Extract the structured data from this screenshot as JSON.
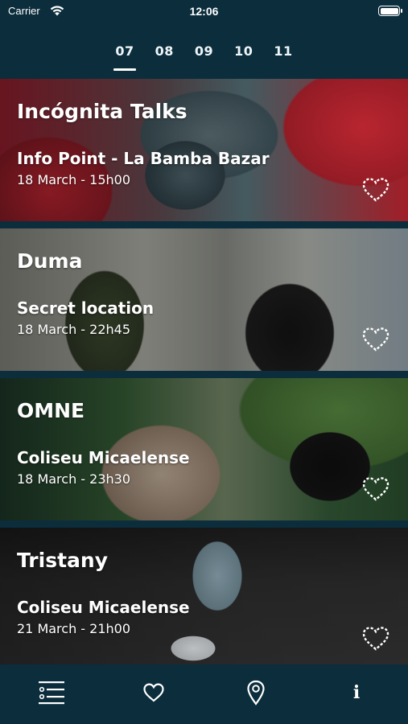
{
  "status_bar": {
    "carrier": "Carrier",
    "time": "12:06",
    "battery_level": 1.0,
    "icons": [
      "wifi-icon",
      "battery-icon"
    ]
  },
  "date_tabs": {
    "selected": "07",
    "items": [
      "07",
      "08",
      "09",
      "10",
      "11"
    ]
  },
  "events": [
    {
      "title": "Incógnita Talks",
      "venue": "Info Point - La Bamba Bazar",
      "date": "18 March - 15h00",
      "favorite": false
    },
    {
      "title": "Duma",
      "venue": "Secret location",
      "date": "18 March - 22h45",
      "favorite": false
    },
    {
      "title": "OMNE",
      "venue": "Coliseu Micaelense",
      "date": "18 March - 23h30",
      "favorite": false
    },
    {
      "title": "Tristany",
      "venue": "Coliseu Micaelense",
      "date": "21 March - 21h00",
      "favorite": false
    }
  ],
  "tab_bar": {
    "items": [
      {
        "icon": "list-icon",
        "selected": true
      },
      {
        "icon": "heart-icon",
        "selected": false
      },
      {
        "icon": "map-pin-icon",
        "selected": false
      },
      {
        "icon": "info-icon",
        "glyph": "i",
        "selected": false
      }
    ]
  },
  "colors": {
    "background": "#0b2d3c",
    "text": "#ffffff"
  }
}
